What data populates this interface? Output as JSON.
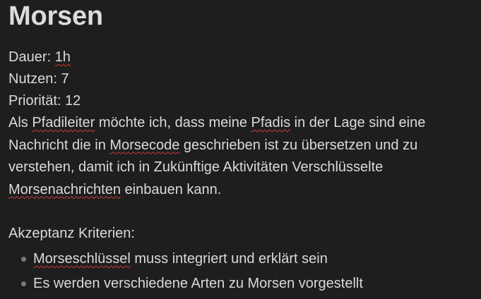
{
  "title": "Morsen",
  "meta": {
    "duration_label": "Dauer: ",
    "duration_value": "1h",
    "benefit_label": "Nutzen: ",
    "benefit_value": "7",
    "priority_label": "Priorität: ",
    "priority_value": "12"
  },
  "description": {
    "p1": "Als ",
    "w1": "Pfadileiter",
    "p2": " möchte ich, dass meine ",
    "w2": "Pfadis",
    "p3": " in der Lage sind eine Nachricht die in ",
    "w3": "Morsecode",
    "p4": " geschrieben ist zu übersetzen und zu verstehen, damit ich in Zukünftige Aktivitäten Verschlüsselte ",
    "w4": "Morsenachrichten",
    "p5": " einbauen kann."
  },
  "criteria": {
    "label": "Akzeptanz Kriterien:",
    "item1_word": "Morseschlüssel",
    "item1_rest": " muss integriert und erklärt sein",
    "item2": "Es werden verschiedene Arten zu Morsen vorgestellt"
  }
}
